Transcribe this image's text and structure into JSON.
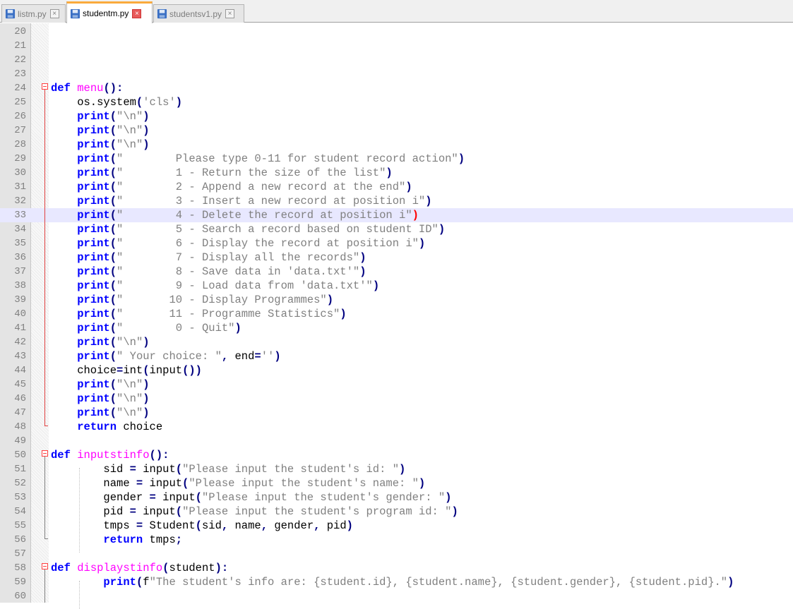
{
  "tabs": [
    {
      "label": "listm.py",
      "active": false
    },
    {
      "label": "studentm.py",
      "active": true
    },
    {
      "label": "studentsv1.py",
      "active": false
    }
  ],
  "tab_close_glyph": "×",
  "colors": {
    "keyword": "#0000ff",
    "function_name": "#ff00ff",
    "string": "#808080",
    "operator": "#000080",
    "current_line": "#e8e8ff",
    "active_tab_accent": "#faaa3c"
  },
  "current_line": 33,
  "lines": [
    {
      "n": "20",
      "code": []
    },
    {
      "n": "21",
      "code": []
    },
    {
      "n": "22",
      "code": []
    },
    {
      "n": "23",
      "code": []
    },
    {
      "n": "24",
      "code": [
        [
          "kw",
          "def"
        ],
        [
          "",
          ""
        ],
        [
          "t",
          " "
        ],
        [
          "fn",
          "menu"
        ],
        [
          "op",
          "():"
        ]
      ]
    },
    {
      "n": "25",
      "code": [
        [
          "t",
          "    os.system"
        ],
        [
          "op",
          "("
        ],
        [
          "st",
          "'cls'"
        ],
        [
          "op",
          ")"
        ]
      ]
    },
    {
      "n": "26",
      "code": [
        [
          "t",
          "    "
        ],
        [
          "kw",
          "print"
        ],
        [
          "op",
          "("
        ],
        [
          "st",
          "\"\\n\""
        ],
        [
          "op",
          ")"
        ]
      ]
    },
    {
      "n": "27",
      "code": [
        [
          "t",
          "    "
        ],
        [
          "kw",
          "print"
        ],
        [
          "op",
          "("
        ],
        [
          "st",
          "\"\\n\""
        ],
        [
          "op",
          ")"
        ]
      ]
    },
    {
      "n": "28",
      "code": [
        [
          "t",
          "    "
        ],
        [
          "kw",
          "print"
        ],
        [
          "op",
          "("
        ],
        [
          "st",
          "\"\\n\""
        ],
        [
          "op",
          ")"
        ]
      ]
    },
    {
      "n": "29",
      "code": [
        [
          "t",
          "    "
        ],
        [
          "kw",
          "print"
        ],
        [
          "op",
          "("
        ],
        [
          "st",
          "\"        Please type 0-11 for student record action\""
        ],
        [
          "op",
          ")"
        ]
      ]
    },
    {
      "n": "30",
      "code": [
        [
          "t",
          "    "
        ],
        [
          "kw",
          "print"
        ],
        [
          "op",
          "("
        ],
        [
          "st",
          "\"        1 - Return the size of the list\""
        ],
        [
          "op",
          ")"
        ]
      ]
    },
    {
      "n": "31",
      "code": [
        [
          "t",
          "    "
        ],
        [
          "kw",
          "print"
        ],
        [
          "op",
          "("
        ],
        [
          "st",
          "\"        2 - Append a new record at the end\""
        ],
        [
          "op",
          ")"
        ]
      ]
    },
    {
      "n": "32",
      "code": [
        [
          "t",
          "    "
        ],
        [
          "kw",
          "print"
        ],
        [
          "op",
          "("
        ],
        [
          "st",
          "\"        3 - Insert a new record at position i\""
        ],
        [
          "op",
          ")"
        ]
      ]
    },
    {
      "n": "33",
      "code": [
        [
          "t",
          "    "
        ],
        [
          "kw",
          "print"
        ],
        [
          "op",
          "("
        ],
        [
          "st",
          "\"        4 - Delete the record at position i\""
        ],
        [
          "nm",
          ")"
        ]
      ]
    },
    {
      "n": "34",
      "code": [
        [
          "t",
          "    "
        ],
        [
          "kw",
          "print"
        ],
        [
          "op",
          "("
        ],
        [
          "st",
          "\"        5 - Search a record based on student ID\""
        ],
        [
          "op",
          ")"
        ]
      ]
    },
    {
      "n": "35",
      "code": [
        [
          "t",
          "    "
        ],
        [
          "kw",
          "print"
        ],
        [
          "op",
          "("
        ],
        [
          "st",
          "\"        6 - Display the record at position i\""
        ],
        [
          "op",
          ")"
        ]
      ]
    },
    {
      "n": "36",
      "code": [
        [
          "t",
          "    "
        ],
        [
          "kw",
          "print"
        ],
        [
          "op",
          "("
        ],
        [
          "st",
          "\"        7 - Display all the records\""
        ],
        [
          "op",
          ")"
        ]
      ]
    },
    {
      "n": "37",
      "code": [
        [
          "t",
          "    "
        ],
        [
          "kw",
          "print"
        ],
        [
          "op",
          "("
        ],
        [
          "st",
          "\"        8 - Save data in 'data.txt'\""
        ],
        [
          "op",
          ")"
        ]
      ]
    },
    {
      "n": "38",
      "code": [
        [
          "t",
          "    "
        ],
        [
          "kw",
          "print"
        ],
        [
          "op",
          "("
        ],
        [
          "st",
          "\"        9 - Load data from 'data.txt'\""
        ],
        [
          "op",
          ")"
        ]
      ]
    },
    {
      "n": "39",
      "code": [
        [
          "t",
          "    "
        ],
        [
          "kw",
          "print"
        ],
        [
          "op",
          "("
        ],
        [
          "st",
          "\"       10 - Display Programmes\""
        ],
        [
          "op",
          ")"
        ]
      ]
    },
    {
      "n": "40",
      "code": [
        [
          "t",
          "    "
        ],
        [
          "kw",
          "print"
        ],
        [
          "op",
          "("
        ],
        [
          "st",
          "\"       11 - Programme Statistics\""
        ],
        [
          "op",
          ")"
        ]
      ]
    },
    {
      "n": "41",
      "code": [
        [
          "t",
          "    "
        ],
        [
          "kw",
          "print"
        ],
        [
          "op",
          "("
        ],
        [
          "st",
          "\"        0 - Quit\""
        ],
        [
          "op",
          ")"
        ]
      ]
    },
    {
      "n": "42",
      "code": [
        [
          "t",
          "    "
        ],
        [
          "kw",
          "print"
        ],
        [
          "op",
          "("
        ],
        [
          "st",
          "\"\\n\""
        ],
        [
          "op",
          ")"
        ]
      ]
    },
    {
      "n": "43",
      "code": [
        [
          "t",
          "    "
        ],
        [
          "kw",
          "print"
        ],
        [
          "op",
          "("
        ],
        [
          "st",
          "\" Your choice: \""
        ],
        [
          "op",
          ","
        ],
        [
          "t",
          " end"
        ],
        [
          "op",
          "="
        ],
        [
          "st",
          "''"
        ],
        [
          "op",
          ")"
        ]
      ]
    },
    {
      "n": "44",
      "code": [
        [
          "t",
          "    choice"
        ],
        [
          "op",
          "="
        ],
        [
          "t",
          "int"
        ],
        [
          "op",
          "("
        ],
        [
          "t",
          "input"
        ],
        [
          "op",
          "())"
        ]
      ]
    },
    {
      "n": "45",
      "code": [
        [
          "t",
          "    "
        ],
        [
          "kw",
          "print"
        ],
        [
          "op",
          "("
        ],
        [
          "st",
          "\"\\n\""
        ],
        [
          "op",
          ")"
        ]
      ]
    },
    {
      "n": "46",
      "code": [
        [
          "t",
          "    "
        ],
        [
          "kw",
          "print"
        ],
        [
          "op",
          "("
        ],
        [
          "st",
          "\"\\n\""
        ],
        [
          "op",
          ")"
        ]
      ]
    },
    {
      "n": "47",
      "code": [
        [
          "t",
          "    "
        ],
        [
          "kw",
          "print"
        ],
        [
          "op",
          "("
        ],
        [
          "st",
          "\"\\n\""
        ],
        [
          "op",
          ")"
        ]
      ]
    },
    {
      "n": "48",
      "code": [
        [
          "t",
          "    "
        ],
        [
          "kw",
          "return"
        ],
        [
          "t",
          " choice"
        ]
      ]
    },
    {
      "n": "49",
      "code": []
    },
    {
      "n": "50",
      "code": [
        [
          "kw",
          "def"
        ],
        [
          "t",
          " "
        ],
        [
          "fn",
          "inputstinfo"
        ],
        [
          "op",
          "():"
        ]
      ]
    },
    {
      "n": "51",
      "code": [
        [
          "t",
          "        sid "
        ],
        [
          "op",
          "="
        ],
        [
          "t",
          " input"
        ],
        [
          "op",
          "("
        ],
        [
          "st",
          "\"Please input the student's id: \""
        ],
        [
          "op",
          ")"
        ]
      ]
    },
    {
      "n": "52",
      "code": [
        [
          "t",
          "        name "
        ],
        [
          "op",
          "="
        ],
        [
          "t",
          " input"
        ],
        [
          "op",
          "("
        ],
        [
          "st",
          "\"Please input the student's name: \""
        ],
        [
          "op",
          ")"
        ]
      ]
    },
    {
      "n": "53",
      "code": [
        [
          "t",
          "        gender "
        ],
        [
          "op",
          "="
        ],
        [
          "t",
          " input"
        ],
        [
          "op",
          "("
        ],
        [
          "st",
          "\"Please input the student's gender: \""
        ],
        [
          "op",
          ")"
        ]
      ]
    },
    {
      "n": "54",
      "code": [
        [
          "t",
          "        pid "
        ],
        [
          "op",
          "="
        ],
        [
          "t",
          " input"
        ],
        [
          "op",
          "("
        ],
        [
          "st",
          "\"Please input the student's program id: \""
        ],
        [
          "op",
          ")"
        ]
      ]
    },
    {
      "n": "55",
      "code": [
        [
          "t",
          "        tmps "
        ],
        [
          "op",
          "="
        ],
        [
          "t",
          " Student"
        ],
        [
          "op",
          "("
        ],
        [
          "t",
          "sid"
        ],
        [
          "op",
          ","
        ],
        [
          "t",
          " name"
        ],
        [
          "op",
          ","
        ],
        [
          "t",
          " gender"
        ],
        [
          "op",
          ","
        ],
        [
          "t",
          " pid"
        ],
        [
          "op",
          ")"
        ]
      ]
    },
    {
      "n": "56",
      "code": [
        [
          "t",
          "        "
        ],
        [
          "kw",
          "return"
        ],
        [
          "t",
          " tmps"
        ],
        [
          "op",
          ";"
        ]
      ]
    },
    {
      "n": "57",
      "code": []
    },
    {
      "n": "58",
      "code": [
        [
          "kw",
          "def"
        ],
        [
          "t",
          " "
        ],
        [
          "fn",
          "displaystinfo"
        ],
        [
          "op",
          "("
        ],
        [
          "t",
          "student"
        ],
        [
          "op",
          "):"
        ]
      ]
    },
    {
      "n": "59",
      "code": [
        [
          "t",
          "        "
        ],
        [
          "kw",
          "print"
        ],
        [
          "op",
          "("
        ],
        [
          "t",
          "f"
        ],
        [
          "st",
          "\"The student's info are: {student.id}, {student.name}, {student.gender}, {student.pid}.\""
        ],
        [
          "op",
          ")"
        ]
      ]
    },
    {
      "n": "60",
      "code": []
    }
  ]
}
